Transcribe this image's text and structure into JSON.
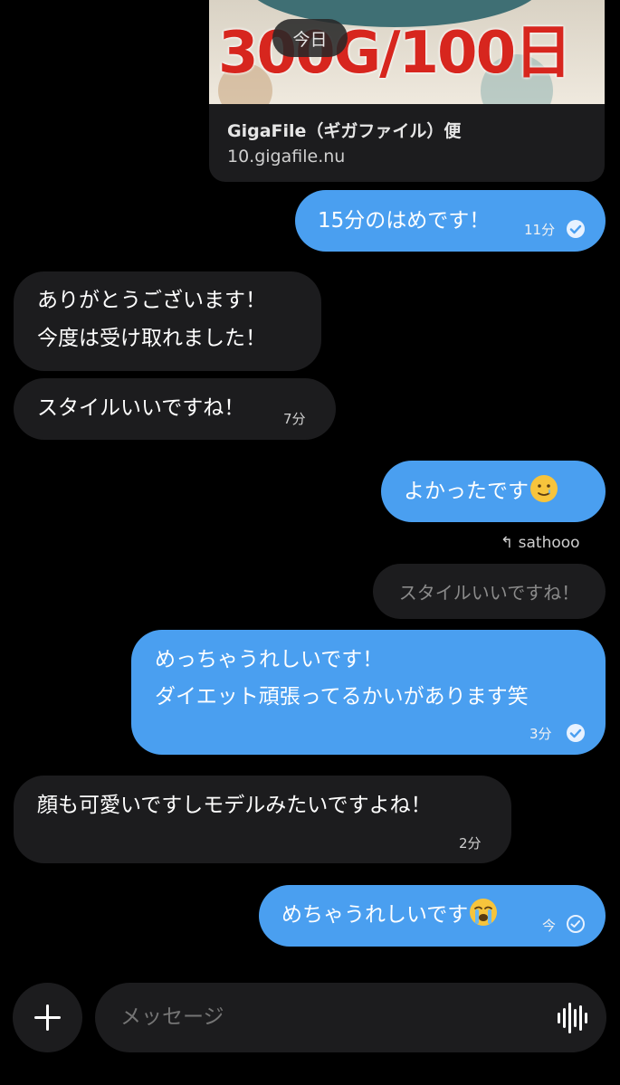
{
  "link_preview": {
    "image_text": "300G/100日",
    "title": "GigaFile（ギガファイル）便",
    "url": "10.gigafile.nu"
  },
  "date_separator": "今日",
  "messages": [
    {
      "text": "15分のはめです！",
      "time": "11分",
      "status": "read"
    },
    {
      "line1": "ありがとうございます！",
      "line2": "今度は受け取れました！"
    },
    {
      "text": "スタイルいいですね！",
      "time": "7分"
    },
    {
      "text": "よかったです",
      "emoji": "smiling-tear-emoji"
    },
    {
      "reply_to": "sathooo",
      "quoted_text": "スタイルいいですね！"
    },
    {
      "line1": "めっちゃうれしいです！",
      "line2": "ダイエット頑張ってるかいがあります笑",
      "time": "3分",
      "status": "read"
    },
    {
      "text": "顔も可愛いですしモデルみたいですよね！",
      "time": "2分"
    },
    {
      "text": "めちゃうれしいです",
      "emoji": "loudly-crying-emoji",
      "time": "今",
      "status": "sent"
    }
  ],
  "composer": {
    "placeholder": "メッセージ",
    "add_icon": "plus-icon",
    "voice_icon": "waveform-icon"
  },
  "colors": {
    "background": "#000000",
    "outgoing_bubble": "#4a9ff0",
    "incoming_bubble": "#1c1c1e"
  }
}
